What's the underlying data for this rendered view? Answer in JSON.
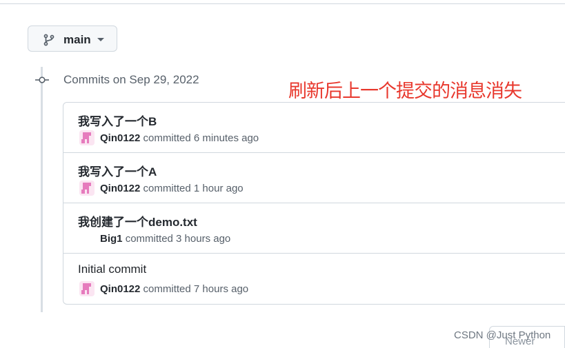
{
  "branch": {
    "label": "main"
  },
  "timeline": {
    "date_heading": "Commits on Sep 29, 2022"
  },
  "annotation": "刷新后上一个提交的消息消失",
  "commits": [
    {
      "title": "我写入了一个B",
      "author": "Qin0122",
      "verb": "committed",
      "time": "6 minutes ago",
      "has_avatar": true
    },
    {
      "title": "我写入了一个A",
      "author": "Qin0122",
      "verb": "committed",
      "time": "1 hour ago",
      "has_avatar": true
    },
    {
      "title": "我创建了一个demo.txt",
      "author": "Big1",
      "verb": "committed",
      "time": "3 hours ago",
      "has_avatar": false
    },
    {
      "title": "Initial commit",
      "author": "Qin0122",
      "verb": "committed",
      "time": "7 hours ago",
      "has_avatar": true
    }
  ],
  "pagination": {
    "newer_label": "Newer"
  },
  "watermark": "CSDN @Just Python",
  "colors": {
    "annotation": "#e8382d",
    "avatar": "#e67bbd",
    "border": "#d0d7de"
  }
}
